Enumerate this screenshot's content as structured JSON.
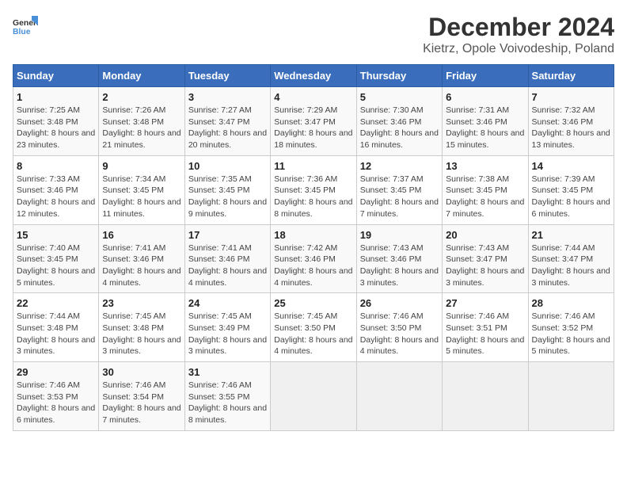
{
  "header": {
    "logo_general": "General",
    "logo_blue": "Blue",
    "title": "December 2024",
    "subtitle": "Kietrz, Opole Voivodeship, Poland"
  },
  "calendar": {
    "days_of_week": [
      "Sunday",
      "Monday",
      "Tuesday",
      "Wednesday",
      "Thursday",
      "Friday",
      "Saturday"
    ],
    "weeks": [
      [
        {
          "day": "1",
          "sunrise": "Sunrise: 7:25 AM",
          "sunset": "Sunset: 3:48 PM",
          "daylight": "Daylight: 8 hours and 23 minutes."
        },
        {
          "day": "2",
          "sunrise": "Sunrise: 7:26 AM",
          "sunset": "Sunset: 3:48 PM",
          "daylight": "Daylight: 8 hours and 21 minutes."
        },
        {
          "day": "3",
          "sunrise": "Sunrise: 7:27 AM",
          "sunset": "Sunset: 3:47 PM",
          "daylight": "Daylight: 8 hours and 20 minutes."
        },
        {
          "day": "4",
          "sunrise": "Sunrise: 7:29 AM",
          "sunset": "Sunset: 3:47 PM",
          "daylight": "Daylight: 8 hours and 18 minutes."
        },
        {
          "day": "5",
          "sunrise": "Sunrise: 7:30 AM",
          "sunset": "Sunset: 3:46 PM",
          "daylight": "Daylight: 8 hours and 16 minutes."
        },
        {
          "day": "6",
          "sunrise": "Sunrise: 7:31 AM",
          "sunset": "Sunset: 3:46 PM",
          "daylight": "Daylight: 8 hours and 15 minutes."
        },
        {
          "day": "7",
          "sunrise": "Sunrise: 7:32 AM",
          "sunset": "Sunset: 3:46 PM",
          "daylight": "Daylight: 8 hours and 13 minutes."
        }
      ],
      [
        {
          "day": "8",
          "sunrise": "Sunrise: 7:33 AM",
          "sunset": "Sunset: 3:46 PM",
          "daylight": "Daylight: 8 hours and 12 minutes."
        },
        {
          "day": "9",
          "sunrise": "Sunrise: 7:34 AM",
          "sunset": "Sunset: 3:45 PM",
          "daylight": "Daylight: 8 hours and 11 minutes."
        },
        {
          "day": "10",
          "sunrise": "Sunrise: 7:35 AM",
          "sunset": "Sunset: 3:45 PM",
          "daylight": "Daylight: 8 hours and 9 minutes."
        },
        {
          "day": "11",
          "sunrise": "Sunrise: 7:36 AM",
          "sunset": "Sunset: 3:45 PM",
          "daylight": "Daylight: 8 hours and 8 minutes."
        },
        {
          "day": "12",
          "sunrise": "Sunrise: 7:37 AM",
          "sunset": "Sunset: 3:45 PM",
          "daylight": "Daylight: 8 hours and 7 minutes."
        },
        {
          "day": "13",
          "sunrise": "Sunrise: 7:38 AM",
          "sunset": "Sunset: 3:45 PM",
          "daylight": "Daylight: 8 hours and 7 minutes."
        },
        {
          "day": "14",
          "sunrise": "Sunrise: 7:39 AM",
          "sunset": "Sunset: 3:45 PM",
          "daylight": "Daylight: 8 hours and 6 minutes."
        }
      ],
      [
        {
          "day": "15",
          "sunrise": "Sunrise: 7:40 AM",
          "sunset": "Sunset: 3:45 PM",
          "daylight": "Daylight: 8 hours and 5 minutes."
        },
        {
          "day": "16",
          "sunrise": "Sunrise: 7:41 AM",
          "sunset": "Sunset: 3:46 PM",
          "daylight": "Daylight: 8 hours and 4 minutes."
        },
        {
          "day": "17",
          "sunrise": "Sunrise: 7:41 AM",
          "sunset": "Sunset: 3:46 PM",
          "daylight": "Daylight: 8 hours and 4 minutes."
        },
        {
          "day": "18",
          "sunrise": "Sunrise: 7:42 AM",
          "sunset": "Sunset: 3:46 PM",
          "daylight": "Daylight: 8 hours and 4 minutes."
        },
        {
          "day": "19",
          "sunrise": "Sunrise: 7:43 AM",
          "sunset": "Sunset: 3:46 PM",
          "daylight": "Daylight: 8 hours and 3 minutes."
        },
        {
          "day": "20",
          "sunrise": "Sunrise: 7:43 AM",
          "sunset": "Sunset: 3:47 PM",
          "daylight": "Daylight: 8 hours and 3 minutes."
        },
        {
          "day": "21",
          "sunrise": "Sunrise: 7:44 AM",
          "sunset": "Sunset: 3:47 PM",
          "daylight": "Daylight: 8 hours and 3 minutes."
        }
      ],
      [
        {
          "day": "22",
          "sunrise": "Sunrise: 7:44 AM",
          "sunset": "Sunset: 3:48 PM",
          "daylight": "Daylight: 8 hours and 3 minutes."
        },
        {
          "day": "23",
          "sunrise": "Sunrise: 7:45 AM",
          "sunset": "Sunset: 3:48 PM",
          "daylight": "Daylight: 8 hours and 3 minutes."
        },
        {
          "day": "24",
          "sunrise": "Sunrise: 7:45 AM",
          "sunset": "Sunset: 3:49 PM",
          "daylight": "Daylight: 8 hours and 3 minutes."
        },
        {
          "day": "25",
          "sunrise": "Sunrise: 7:45 AM",
          "sunset": "Sunset: 3:50 PM",
          "daylight": "Daylight: 8 hours and 4 minutes."
        },
        {
          "day": "26",
          "sunrise": "Sunrise: 7:46 AM",
          "sunset": "Sunset: 3:50 PM",
          "daylight": "Daylight: 8 hours and 4 minutes."
        },
        {
          "day": "27",
          "sunrise": "Sunrise: 7:46 AM",
          "sunset": "Sunset: 3:51 PM",
          "daylight": "Daylight: 8 hours and 5 minutes."
        },
        {
          "day": "28",
          "sunrise": "Sunrise: 7:46 AM",
          "sunset": "Sunset: 3:52 PM",
          "daylight": "Daylight: 8 hours and 5 minutes."
        }
      ],
      [
        {
          "day": "29",
          "sunrise": "Sunrise: 7:46 AM",
          "sunset": "Sunset: 3:53 PM",
          "daylight": "Daylight: 8 hours and 6 minutes."
        },
        {
          "day": "30",
          "sunrise": "Sunrise: 7:46 AM",
          "sunset": "Sunset: 3:54 PM",
          "daylight": "Daylight: 8 hours and 7 minutes."
        },
        {
          "day": "31",
          "sunrise": "Sunrise: 7:46 AM",
          "sunset": "Sunset: 3:55 PM",
          "daylight": "Daylight: 8 hours and 8 minutes."
        },
        null,
        null,
        null,
        null
      ]
    ]
  }
}
